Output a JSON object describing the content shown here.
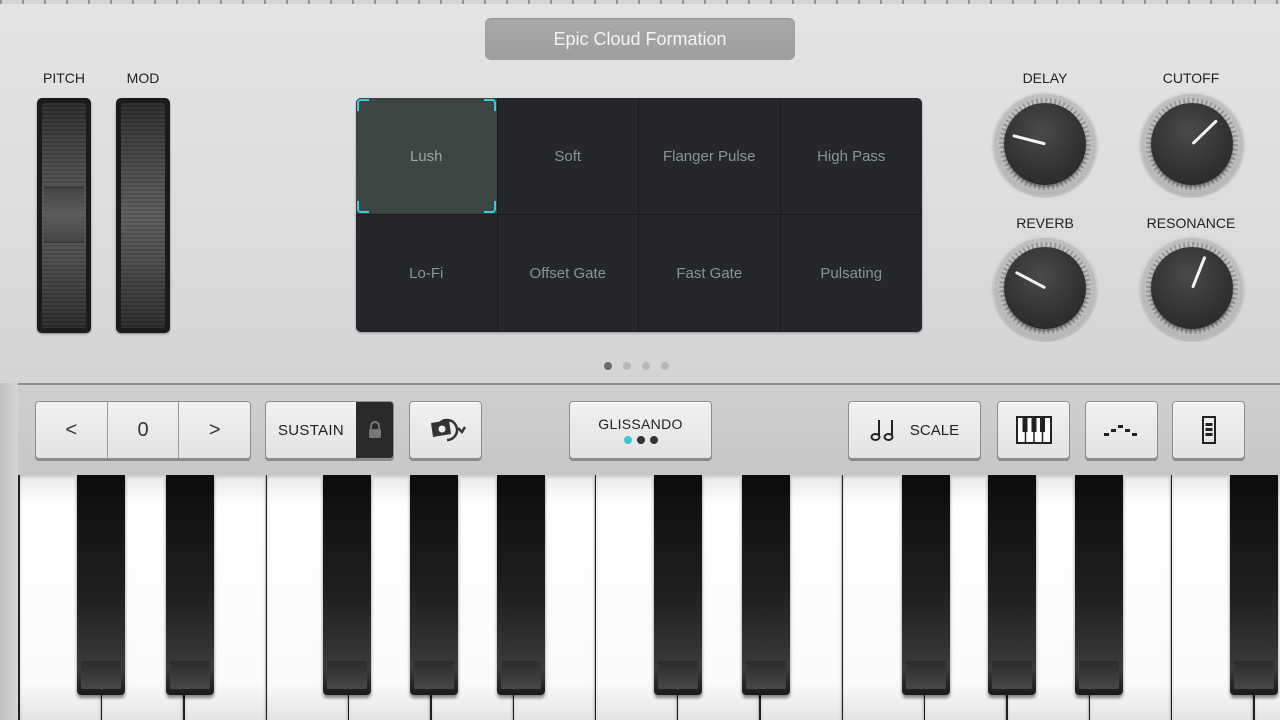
{
  "patch": {
    "title": "Epic Cloud Formation"
  },
  "wheels": {
    "pitch_label": "PITCH",
    "mod_label": "MOD"
  },
  "presets": {
    "items": [
      "Lush",
      "Soft",
      "Flanger Pulse",
      "High Pass",
      "Lo-Fi",
      "Offset Gate",
      "Fast Gate",
      "Pulsating"
    ],
    "selected": "Lush",
    "page_count": 4,
    "current_page": 1
  },
  "knobs": {
    "delay": {
      "label": "DELAY",
      "value_fraction": 0.22
    },
    "cutoff": {
      "label": "CUTOFF",
      "value_fraction": 0.67
    },
    "reverb": {
      "label": "REVERB",
      "value_fraction": 0.27
    },
    "resonance": {
      "label": "RESONANCE",
      "value_fraction": 0.58
    }
  },
  "controls": {
    "octave_prev": "<",
    "octave_value": "0",
    "octave_next": ">",
    "sustain_label": "SUSTAIN",
    "glissando_label": "GLISSANDO",
    "glissando_mode_count": 3,
    "glissando_active_mode": 1,
    "scale_label": "SCALE"
  },
  "icons": {
    "lock": "lock-icon",
    "arpeggiator": "arpeggiator-icon",
    "scale": "music-notes-icon",
    "keyboard": "keyboard-layout-icon",
    "arp-pattern": "arp-pattern-icon",
    "velocity": "velocity-icon"
  },
  "colors": {
    "accent": "#3fc6d8",
    "pad_bg": "#25272b",
    "selected_pad": "#3b4643"
  }
}
